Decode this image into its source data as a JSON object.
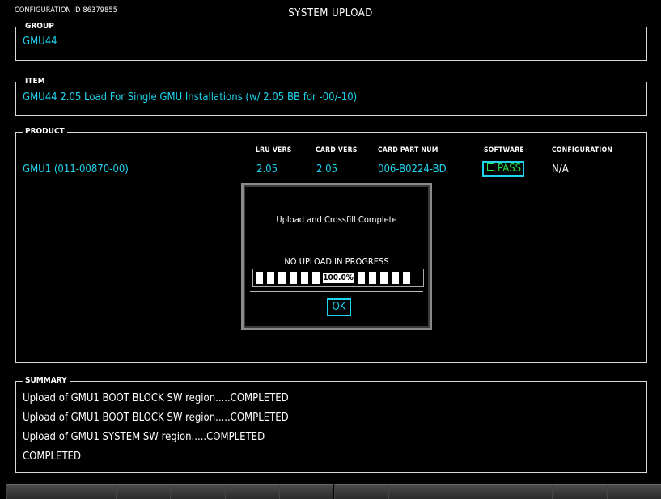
{
  "header": {
    "config_id": "CONFIGURATION ID 86379855",
    "title": "SYSTEM UPLOAD"
  },
  "group": {
    "legend": "GROUP",
    "value": "GMU44"
  },
  "item": {
    "legend": "ITEM",
    "value": "GMU44 2.05 Load For Single GMU Installations (w/ 2.05 BB for -00/-10)"
  },
  "product": {
    "legend": "PRODUCT",
    "columns": {
      "lru_vers": "LRU VERS",
      "card_vers": "CARD VERS",
      "card_part_num": "CARD PART NUM",
      "software": "SOFTWARE",
      "configuration": "CONFIGURATION"
    },
    "row": {
      "name": "GMU1 (011-00870-00)",
      "lru_vers": "2.05",
      "card_vers": "2.05",
      "card_part_num": "006-B0224-BD",
      "software": "PASS",
      "configuration": "N/A"
    }
  },
  "dialog": {
    "message": "Upload and Crossfill Complete",
    "status": "NO UPLOAD IN PROGRESS",
    "progress_label": "100.0%",
    "progress_fraction": 1.0,
    "ok_label": "OK"
  },
  "summary": {
    "legend": "SUMMARY",
    "lines": [
      "Upload of GMU1 BOOT BLOCK SW region.....COMPLETED",
      "Upload of GMU1 BOOT BLOCK SW region.....COMPLETED",
      "Upload of GMU1 SYSTEM SW region.....COMPLETED",
      "COMPLETED"
    ]
  },
  "softkeys": [
    "",
    "",
    "",
    "",
    "",
    "",
    "",
    "",
    "",
    "",
    "",
    ""
  ],
  "colors": {
    "background": "#000000",
    "text": "#ffffff",
    "cyan": "#1fd3ee",
    "green": "#27e04a"
  }
}
